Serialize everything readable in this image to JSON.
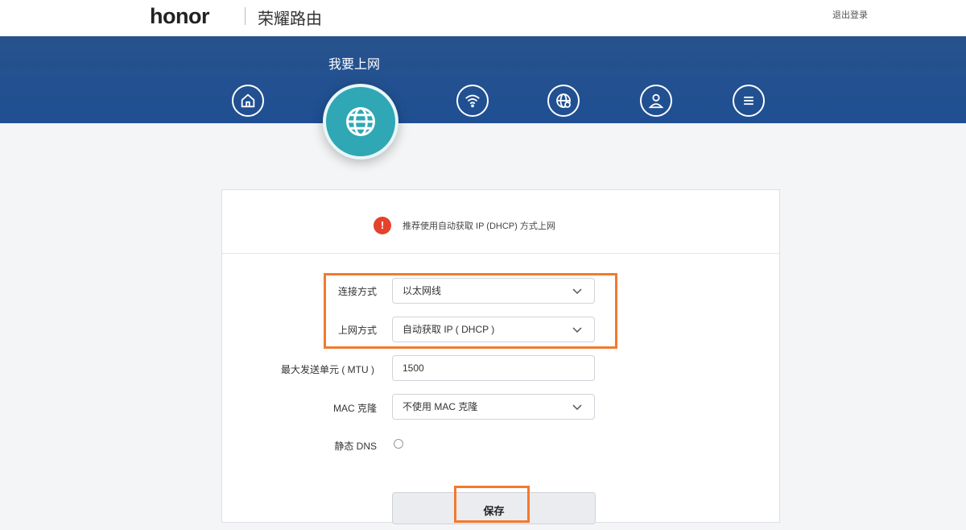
{
  "header": {
    "logo": "honor",
    "product_name": "荣耀路由",
    "logout": "退出登录"
  },
  "nav": {
    "active_title": "我要上网",
    "items": [
      {
        "name": "home-icon"
      },
      {
        "name": "globe-icon",
        "active": true
      },
      {
        "name": "wifi-icon"
      },
      {
        "name": "network-settings-icon"
      },
      {
        "name": "user-icon"
      },
      {
        "name": "menu-icon"
      }
    ]
  },
  "alert": {
    "icon": "!",
    "text": "推荐使用自动获取 IP (DHCP) 方式上网"
  },
  "form": {
    "connection_type_label": "连接方式",
    "connection_type_value": "以太网线",
    "internet_mode_label": "上网方式",
    "internet_mode_value": "自动获取 IP ( DHCP )",
    "mtu_label": "最大发送单元 ( MTU )",
    "mtu_value": "1500",
    "mac_clone_label": "MAC 克隆",
    "mac_clone_value": "不使用 MAC 克隆",
    "static_dns_label": "静态 DNS",
    "save_label": "保存"
  },
  "colors": {
    "nav_band": "#1f4f93",
    "active_icon": "#2fa7b4",
    "alert": "#e4422c",
    "highlight": "#f27a2e"
  }
}
